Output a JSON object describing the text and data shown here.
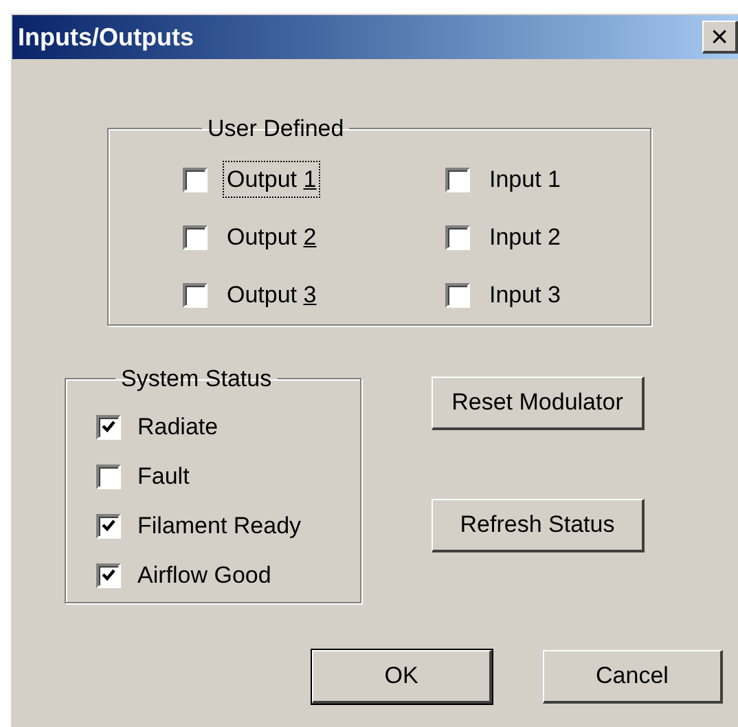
{
  "window": {
    "title": "Inputs/Outputs",
    "close": "×"
  },
  "user_defined": {
    "title": "User Defined",
    "items": [
      {
        "label": "Output 1",
        "checked": false,
        "last_char_underlined": true,
        "focused": true
      },
      {
        "label": "Input 1",
        "checked": false,
        "last_char_underlined": false,
        "focused": false
      },
      {
        "label": "Output 2",
        "checked": false,
        "last_char_underlined": true,
        "focused": false
      },
      {
        "label": "Input 2",
        "checked": false,
        "last_char_underlined": false,
        "focused": false
      },
      {
        "label": "Output 3",
        "checked": false,
        "last_char_underlined": true,
        "focused": false
      },
      {
        "label": "Input 3",
        "checked": false,
        "last_char_underlined": false,
        "focused": false
      }
    ]
  },
  "system_status": {
    "title": "System Status",
    "items": [
      {
        "label": "Radiate",
        "checked": true
      },
      {
        "label": "Fault",
        "checked": false
      },
      {
        "label": "Filament Ready",
        "checked": true
      },
      {
        "label": "Airflow Good",
        "checked": true
      }
    ]
  },
  "side_buttons": [
    "Reset Modulator",
    "Refresh Status"
  ],
  "buttons": [
    {
      "label": "OK",
      "default": true
    },
    {
      "label": "Cancel",
      "default": false
    }
  ]
}
